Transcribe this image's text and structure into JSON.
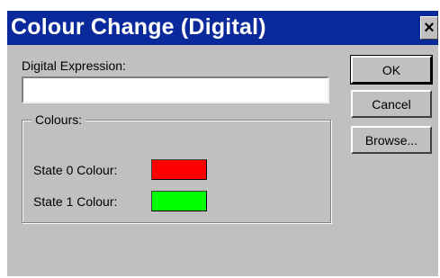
{
  "window": {
    "title": "Colour Change (Digital)",
    "close_glyph": "×"
  },
  "form": {
    "expression_label": "Digital Expression:",
    "expression_value": ""
  },
  "colours_group": {
    "legend": "Colours:",
    "states": [
      {
        "label": "State 0 Colour:",
        "color": "#ff0000"
      },
      {
        "label": "State 1 Colour:",
        "color": "#00ff00"
      }
    ]
  },
  "buttons": {
    "ok": "OK",
    "cancel": "Cancel",
    "browse": "Browse..."
  },
  "colors": {
    "titlebar": "#0a2a9c",
    "dialog_bg": "#c0c0c0"
  }
}
